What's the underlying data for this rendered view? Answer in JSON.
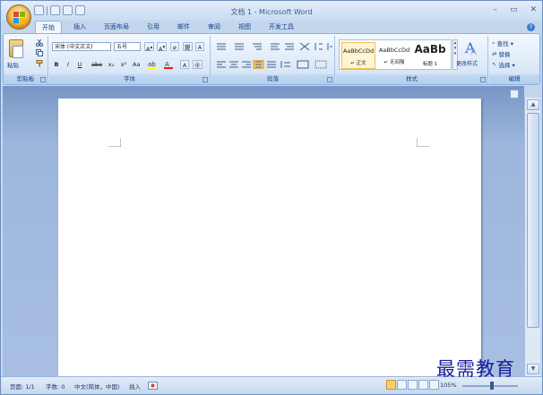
{
  "window": {
    "title": "文档 1 - Microsoft Word"
  },
  "window_controls": {
    "minimize": "–",
    "restore": "▭",
    "close": "✕"
  },
  "qat_icons": [
    "save-icon",
    "undo-icon",
    "redo-icon",
    "print-preview-icon"
  ],
  "tabs": [
    {
      "label": "开始",
      "active": true
    },
    {
      "label": "插入"
    },
    {
      "label": "页面布局"
    },
    {
      "label": "引用"
    },
    {
      "label": "邮件"
    },
    {
      "label": "审阅"
    },
    {
      "label": "视图"
    },
    {
      "label": "开发工具"
    }
  ],
  "ribbon": {
    "clipboard": {
      "paste": "粘贴",
      "group": "剪贴板"
    },
    "font": {
      "font_name": "宋体 (中文正文)",
      "font_size": "五号",
      "group": "字体",
      "row2": [
        "B",
        "I",
        "U",
        "abe",
        "x₂",
        "x²",
        "Aa"
      ]
    },
    "paragraph": {
      "group": "段落"
    },
    "styles": {
      "group": "样式",
      "items": [
        {
          "sample": "AaBbCcDd",
          "name": "↵ 正文",
          "selected": true
        },
        {
          "sample": "AaBbCcDd",
          "name": "↵ 无间隔"
        },
        {
          "sample": "AaBb",
          "name": "标题 1",
          "big": true
        }
      ],
      "change_styles": "更改样式"
    },
    "editing": {
      "group": "编辑",
      "find": "查找 ▾",
      "replace": "替换",
      "select": "选择 ▾"
    }
  },
  "status": {
    "page": "页面: 1/1",
    "words": "字数: 0",
    "language": "中文(简体，中国)",
    "mode": "插入",
    "zoom": "105%"
  },
  "watermark": "最需教育",
  "colors": {
    "accent": "#15428b",
    "doc_bg": "#a8bfe2",
    "selected_style": "#fff5d4"
  }
}
